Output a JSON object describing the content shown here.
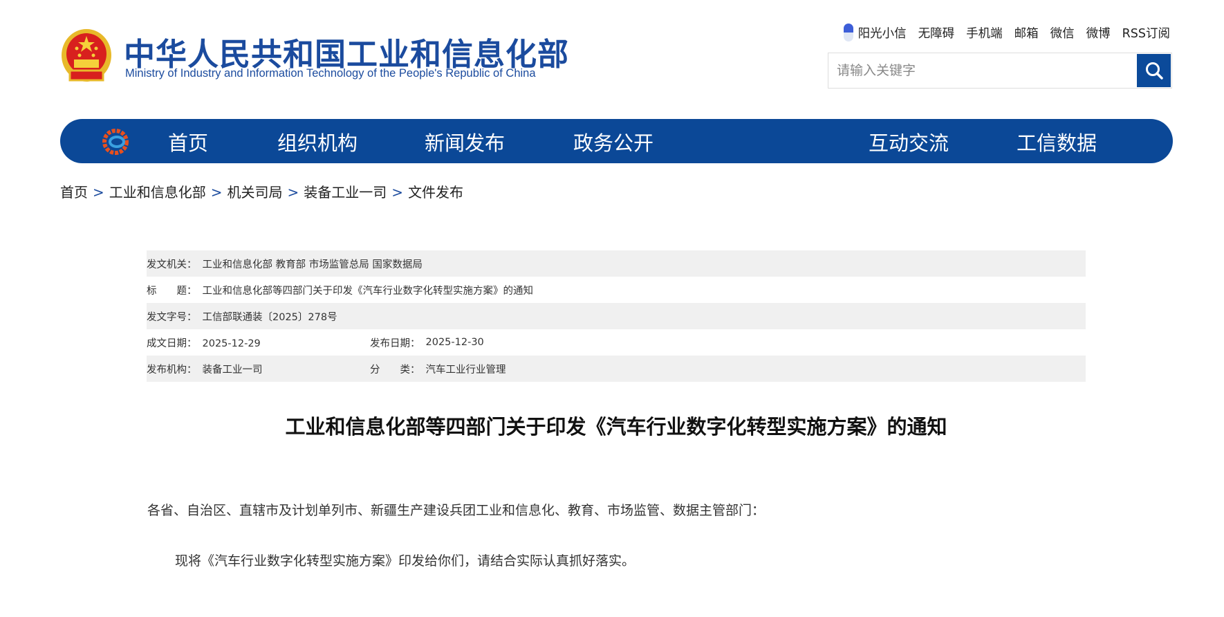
{
  "header": {
    "title": "中华人民共和国工业和信息化部",
    "subtitle": "Ministry of Industry and Information Technology of the People's Republic of China",
    "top_links": [
      "阳光小信",
      "无障碍",
      "手机端",
      "邮箱",
      "微信",
      "微博",
      "RSS订阅"
    ],
    "search_placeholder": "请输入关键字"
  },
  "nav": {
    "items": [
      "首页",
      "组织机构",
      "新闻发布",
      "政务公开",
      "互动交流",
      "工信数据"
    ]
  },
  "breadcrumb": [
    "首页",
    "工业和信息化部",
    "机关司局",
    "装备工业一司",
    "文件发布"
  ],
  "breadcrumb_sep": ">",
  "meta": {
    "issuer_label": "发文机关：",
    "issuer": "工业和信息化部 教育部 市场监管总局 国家数据局",
    "title_label": "标　　题：",
    "title": "工业和信息化部等四部门关于印发《汽车行业数字化转型实施方案》的通知",
    "docno_label": "发文字号：",
    "docno": "工信部联通装〔2025〕278号",
    "written_label": "成文日期：",
    "written": "2025-12-29",
    "published_label": "发布日期：",
    "published": "2025-12-30",
    "org_label": "发布机构：",
    "org": "装备工业一司",
    "category_label": "分　　类：",
    "category": "汽车工业行业管理"
  },
  "document": {
    "title": "工业和信息化部等四部门关于印发《汽车行业数字化转型实施方案》的通知",
    "salutation": "各省、自治区、直辖市及计划单列市、新疆生产建设兵团工业和信息化、教育、市场监管、数据主管部门：",
    "body": "现将《汽车行业数字化转型实施方案》印发给你们，请结合实际认真抓好落实。"
  },
  "colors": {
    "brand": "#0b4897",
    "title": "#1b4b9e"
  }
}
